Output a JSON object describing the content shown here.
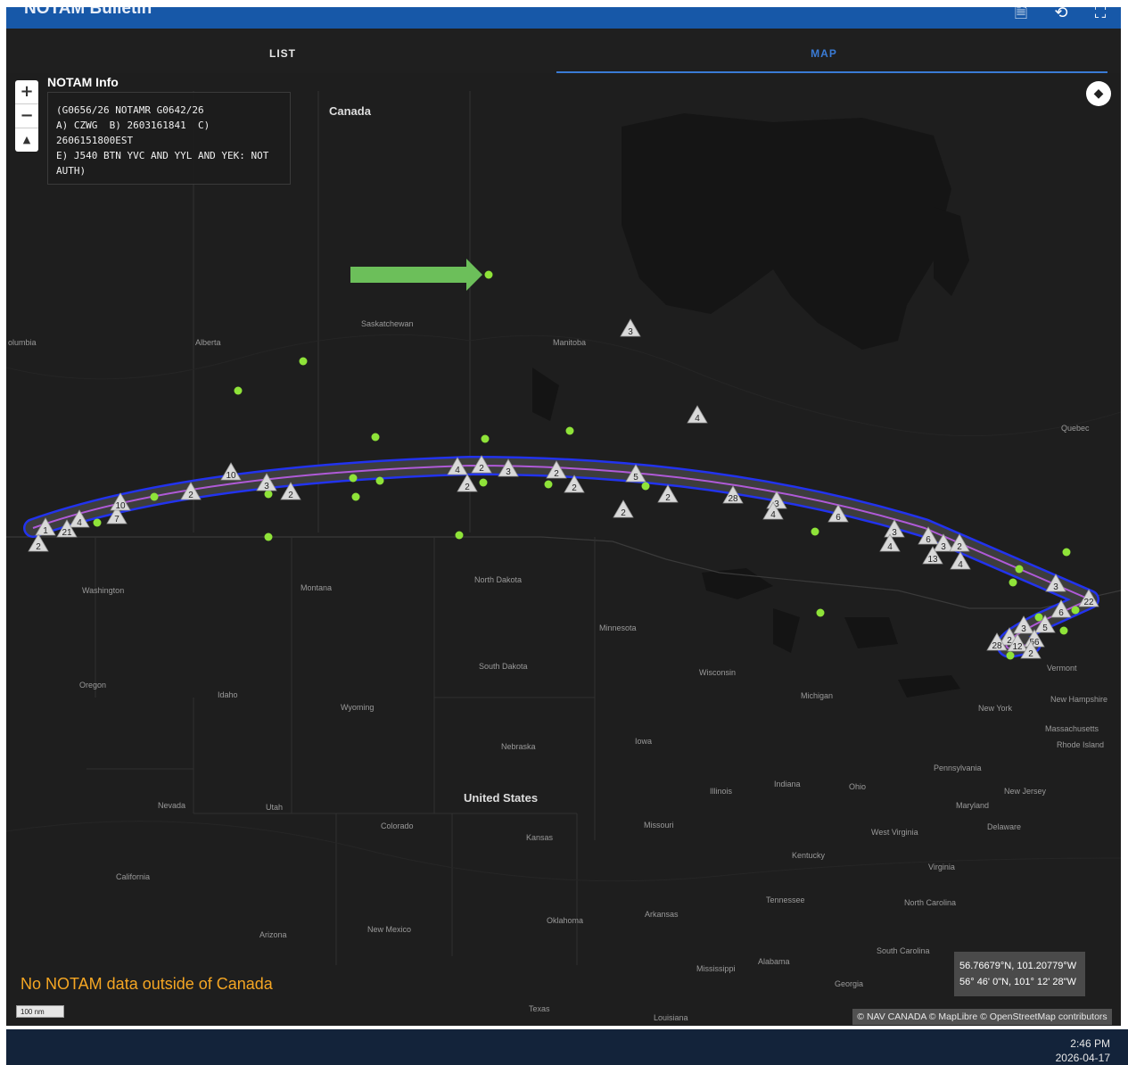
{
  "app": {
    "title": "NOTAM Bulletin"
  },
  "tabs": {
    "list": "LIST",
    "map": "MAP"
  },
  "notam": {
    "title": "NOTAM Info",
    "text": "(G0656/26 NOTAMR G0642/26\nA) CZWG  B) 2603161841  C)\n2606151800EST\nE) J540 BTN YVC AND YYL AND YEK: NOT\nAUTH)"
  },
  "zoom": {
    "in": "+",
    "out": "−",
    "compass": "▲"
  },
  "map_labels": {
    "canada": "Canada",
    "united_states": "United States",
    "british_columbia": "olumbia",
    "alberta": "Alberta",
    "saskatchewan": "Saskatchewan",
    "manitoba": "Manitoba",
    "quebec": "Quebec",
    "washington": "Washington",
    "montana": "Montana",
    "north_dakota": "North Dakota",
    "minnesota": "Minnesota",
    "south_dakota": "South Dakota",
    "wisconsin": "Wisconsin",
    "oregon": "Oregon",
    "idaho": "Idaho",
    "wyoming": "Wyoming",
    "michigan": "Michigan",
    "vermont": "Vermont",
    "new_hampshire": "New Hampshire",
    "new_york": "New York",
    "massachusetts": "Massachusetts",
    "rhode_island": "Rhode Island",
    "iowa": "Iowa",
    "nebraska": "Nebraska",
    "pennsylvania": "Pennsylvania",
    "new_jersey": "New Jersey",
    "illinois": "Illinois",
    "indiana": "Indiana",
    "ohio": "Ohio",
    "maryland": "Maryland",
    "nevada": "Nevada",
    "utah": "Utah",
    "colorado": "Colorado",
    "kansas": "Kansas",
    "missouri": "Missouri",
    "west_virginia": "West Virginia",
    "delaware": "Delaware",
    "kentucky": "Kentucky",
    "virginia": "Virginia",
    "california": "California",
    "tennessee": "Tennessee",
    "north_carolina": "North Carolina",
    "oklahoma": "Oklahoma",
    "arkansas": "Arkansas",
    "arizona": "Arizona",
    "new_mexico": "New Mexico",
    "south_carolina": "South Carolina",
    "mississippi": "Mississippi",
    "alabama": "Alabama",
    "georgia": "Georgia",
    "texas": "Texas",
    "louisiana": "Louisiana"
  },
  "markers": {
    "m01": "1",
    "m02": "4",
    "m03": "21",
    "m04": "2",
    "m05": "7",
    "m06": "10",
    "m07": "2",
    "m08": "10",
    "m09": "3",
    "m10": "2",
    "m11": "4",
    "m12": "2",
    "m13": "2",
    "m14": "3",
    "m15": "2",
    "m16": "2",
    "m17": "5",
    "m18": "2",
    "m19": "2",
    "m20": "28",
    "m21": "3",
    "m22": "4",
    "m23": "6",
    "m24": "3",
    "m25": "4",
    "m26": "6",
    "m27": "3",
    "m28": "2",
    "m29": "13",
    "m30": "4",
    "m31": "3",
    "m32": "22",
    "m33": "6",
    "m34": "5",
    "m35": "3",
    "m36": "2",
    "m37": "12",
    "m38": "28",
    "m39": "56",
    "m40": "2",
    "m41": "3",
    "m42": "4"
  },
  "no_data_notice": "No NOTAM data outside of Canada",
  "scale": "100 nm",
  "coordinates": {
    "decimal": "56.76679°N, 101.20779°W",
    "dms": "56° 46' 0\"N, 101° 12' 28\"W"
  },
  "attribution": "© NAV CANADA © MapLibre © OpenStreetMap contributors",
  "taskbar": {
    "time": "2:46 PM",
    "date": "2026-04-17"
  },
  "colors": {
    "header": "#1758a8",
    "accent": "#3a7bd5",
    "route_outline": "#2233ee",
    "route_center": "#b05ad8",
    "dot": "#8fe339",
    "arrow": "#6cbf5a",
    "warning": "#f5a623"
  }
}
